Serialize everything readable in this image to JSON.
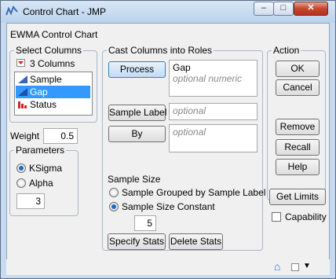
{
  "window": {
    "title": "Control Chart - JMP",
    "minimize": "–",
    "maximize": "□",
    "close": "✕"
  },
  "header": {
    "label": "EWMA Control Chart"
  },
  "select_columns": {
    "title": "Select Columns",
    "count_label": "3 Columns",
    "columns": [
      {
        "name": "Sample",
        "type": "continuous"
      },
      {
        "name": "Gap",
        "type": "continuous",
        "selected": true
      },
      {
        "name": "Status",
        "type": "nominal"
      }
    ]
  },
  "cast_roles": {
    "title": "Cast Columns into Roles",
    "process": {
      "button": "Process",
      "value": "Gap",
      "hint": "optional numeric"
    },
    "sample_label": {
      "button": "Sample Label",
      "hint": "optional"
    },
    "by": {
      "button": "By",
      "hint": "optional"
    }
  },
  "action": {
    "title": "Action",
    "ok": "OK",
    "cancel": "Cancel",
    "remove": "Remove",
    "recall": "Recall",
    "help": "Help"
  },
  "weight": {
    "label": "Weight",
    "value": "0.5"
  },
  "parameters": {
    "title": "Parameters",
    "options": [
      "KSigma",
      "Alpha"
    ],
    "selected": "KSigma",
    "value": "3"
  },
  "sample_size": {
    "title": "Sample Size",
    "options": [
      "Sample Grouped by Sample Label",
      "Sample Size Constant"
    ],
    "selected": "Sample Size Constant",
    "value": "5",
    "specify_stats": "Specify Stats",
    "delete_stats": "Delete Stats"
  },
  "extras": {
    "get_limits": "Get Limits",
    "capability": "Capability"
  },
  "statusbar": {
    "home": "⌂",
    "dropdown": "▼"
  }
}
